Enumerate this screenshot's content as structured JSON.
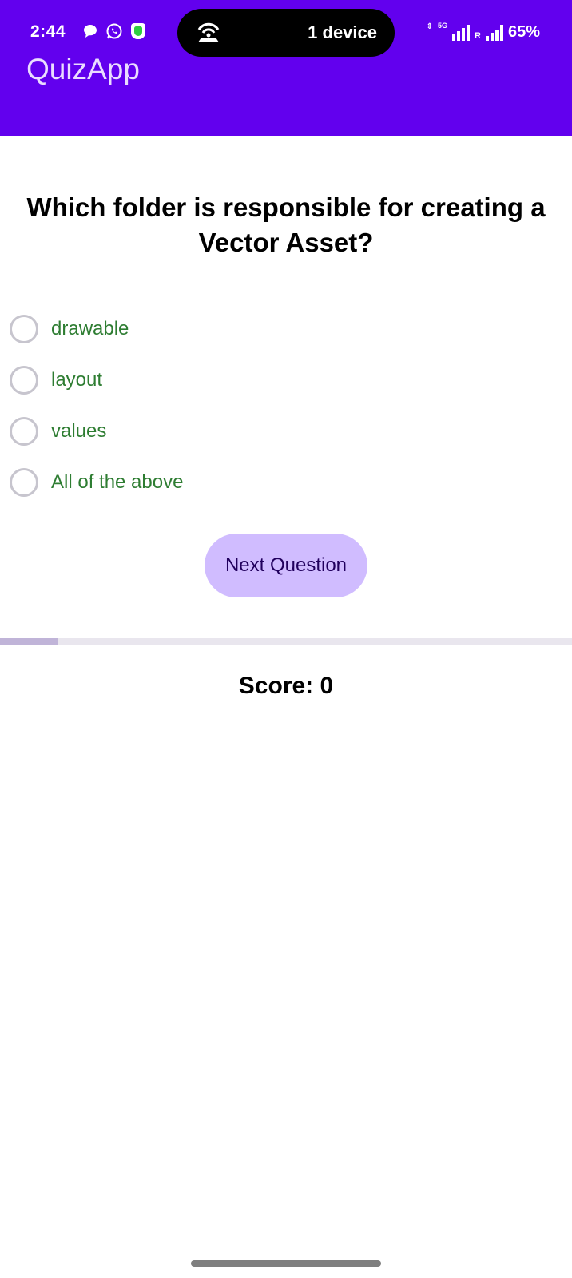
{
  "status_bar": {
    "time": "2:44",
    "cast_text": "1 device",
    "network": "5G",
    "roaming": "R",
    "battery": "65%"
  },
  "app": {
    "title": "QuizApp"
  },
  "quiz": {
    "question": "Which folder is responsible for creating a Vector Asset?",
    "options": [
      {
        "label": "drawable",
        "selected": false
      },
      {
        "label": "layout",
        "selected": false
      },
      {
        "label": "values",
        "selected": false
      },
      {
        "label": "All of the above",
        "selected": false
      }
    ],
    "next_label": "Next Question",
    "progress": 0.1,
    "score_text": "Score: 0"
  },
  "colors": {
    "app_bar": "#6200ee",
    "option_text": "#2e7d32",
    "button_bg": "#d0bcff"
  }
}
